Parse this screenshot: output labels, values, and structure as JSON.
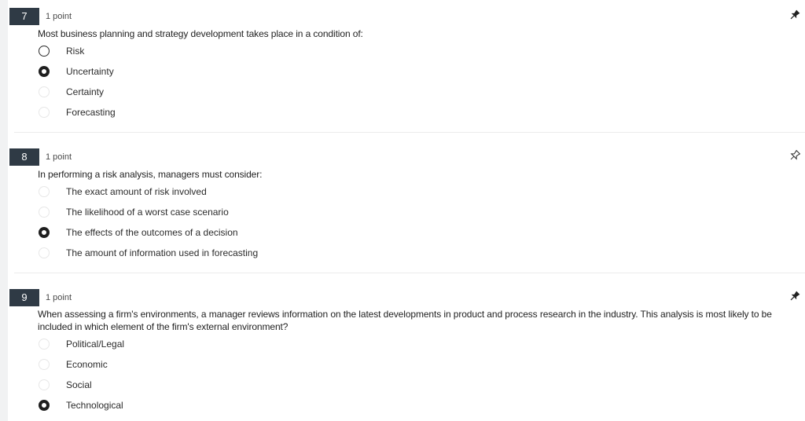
{
  "questions": [
    {
      "number": "7",
      "points": "1 point",
      "prompt": "Most business planning and strategy development takes place in a condition of:",
      "pin_icon": "pin-filled-icon",
      "options": [
        {
          "label": "Risk",
          "state": "unselected-dark"
        },
        {
          "label": "Uncertainty",
          "state": "selected"
        },
        {
          "label": "Certainty",
          "state": "unselected"
        },
        {
          "label": "Forecasting",
          "state": "unselected"
        }
      ]
    },
    {
      "number": "8",
      "points": "1 point",
      "prompt": "In performing a risk analysis, managers must consider:",
      "pin_icon": "pin-outline-icon",
      "options": [
        {
          "label": "The exact amount of risk involved",
          "state": "unselected"
        },
        {
          "label": "The likelihood of a worst case scenario",
          "state": "unselected"
        },
        {
          "label": "The effects of the outcomes of a decision",
          "state": "selected"
        },
        {
          "label": "The amount of information used in forecasting",
          "state": "unselected"
        }
      ]
    },
    {
      "number": "9",
      "points": "1 point",
      "prompt": "When assessing a firm's environments, a manager reviews information on the latest developments in product and process research in the industry. This analysis is most likely to be included in which element of the firm's external environment?",
      "pin_icon": "pin-filled-icon",
      "options": [
        {
          "label": "Political/Legal",
          "state": "unselected"
        },
        {
          "label": "Economic",
          "state": "unselected"
        },
        {
          "label": "Social",
          "state": "unselected"
        },
        {
          "label": "Technological",
          "state": "selected"
        }
      ]
    }
  ],
  "colors": {
    "number_badge": "#2f3a45",
    "rail": "#f1f2f3",
    "radio_selected": "#1f1f1f",
    "radio_unselected_border": "#e7e7e7"
  }
}
